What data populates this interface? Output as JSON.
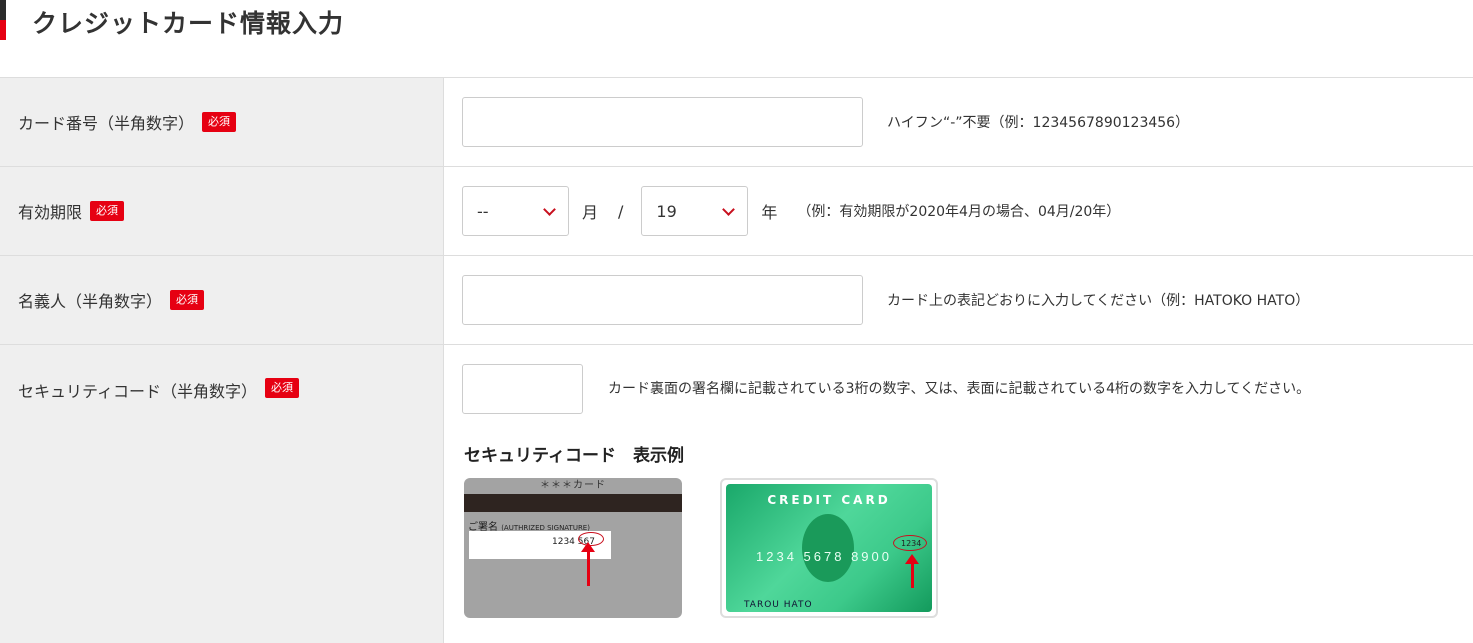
{
  "page": {
    "title": "クレジットカード情報入力"
  },
  "required_label": "必須",
  "card_number": {
    "label": "カード番号（半角数字）",
    "value": "",
    "hint": "ハイフン“-”不要（例：1234567890123456）"
  },
  "expiry": {
    "label": "有効期限",
    "month_value": "--",
    "month_unit": "月",
    "separator": "/",
    "year_value": "19",
    "year_unit": "年",
    "hint": "（例：有効期限が2020年4月の場合、04月/20年）"
  },
  "holder": {
    "label": "名義人（半角数字）",
    "value": "",
    "hint": "カード上の表記どおりに入力してください（例：HATOKO HATO）"
  },
  "security": {
    "label": "セキュリティコード（半角数字）",
    "value": "",
    "hint": "カード裏面の署名欄に記載されている3桁の数字、又は、表面に記載されている4桁の数字を入力してください。",
    "example_title": "セキュリティコード　表示例"
  },
  "card_back_image": {
    "header": "＊＊＊カード",
    "signature_label": "ご署名",
    "signature_sub": "(AUTHRIZED SIGNATURE)",
    "number": "1234",
    "code": "567"
  },
  "card_front_image": {
    "brand": "CREDIT CARD",
    "number": "1234 5678 8900",
    "code": "1234",
    "holder": "TAROU HATO"
  },
  "colors": {
    "accent_red": "#e60012",
    "label_bg": "#efefef",
    "border": "#dddddd"
  }
}
